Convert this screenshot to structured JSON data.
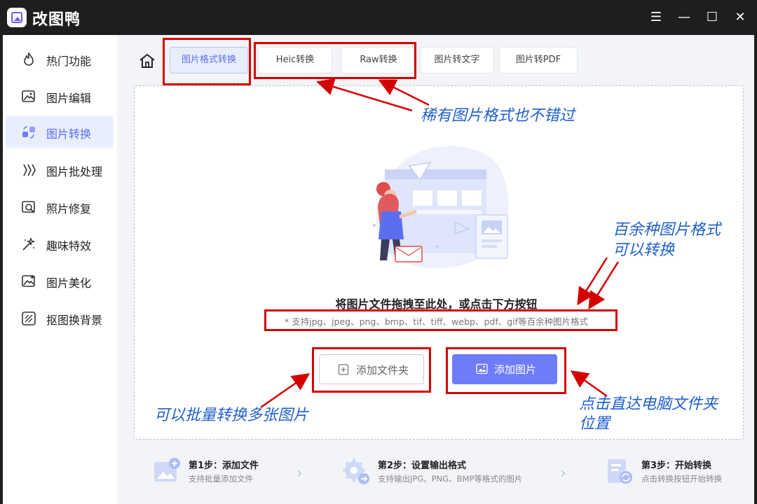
{
  "app": {
    "title": "改图鸭"
  },
  "window_controls": {
    "menu": "☰",
    "minimize": "—",
    "maximize": "☐",
    "close": "✕"
  },
  "sidebar": {
    "items": [
      {
        "label": "热门功能",
        "icon": "flame-icon"
      },
      {
        "label": "图片编辑",
        "icon": "image-edit-icon"
      },
      {
        "label": "图片转换",
        "icon": "convert-icon",
        "active": true
      },
      {
        "label": "图片批处理",
        "icon": "batch-icon"
      },
      {
        "label": "照片修复",
        "icon": "photo-repair-icon"
      },
      {
        "label": "趣味特效",
        "icon": "magic-wand-icon"
      },
      {
        "label": "图片美化",
        "icon": "beautify-icon"
      },
      {
        "label": "抠图换背景",
        "icon": "cutout-icon"
      }
    ]
  },
  "tabs": [
    {
      "label": "图片格式转换",
      "active": true
    },
    {
      "label": "Heic转换"
    },
    {
      "label": "Raw转换"
    },
    {
      "label": "图片转文字"
    },
    {
      "label": "图片转PDF"
    }
  ],
  "dropzone": {
    "title": "将图片文件拖拽至此处，或点击下方按钮",
    "supported": "* 支持jpg、jpeg、png、bmp、tif、tiff、webp、pdf、gif等百余种图片格式",
    "add_folder": "添加文件夹",
    "add_image": "添加图片"
  },
  "steps": [
    {
      "title": "第1步：添加文件",
      "desc": "支持批量添加文件"
    },
    {
      "title": "第2步：设置输出格式",
      "desc": "支持输出JPG、PNG、BMP等格式的图片"
    },
    {
      "title": "第3步：开始转换",
      "desc": "点击转换按钮开始转换"
    }
  ],
  "annotations": {
    "rare_formats": "稀有图片格式也不错过",
    "hundred_formats_1": "百余种图片格式",
    "hundred_formats_2": "可以转换",
    "batch": "可以批量转换多张图片",
    "direct_1": "点击直达电脑文件夹",
    "direct_2": "位置"
  },
  "colors": {
    "accent": "#6f7cf8",
    "annotation_red": "#d40000",
    "annotation_blue": "#1f5fcc",
    "titlebar": "#1e1e1e"
  }
}
